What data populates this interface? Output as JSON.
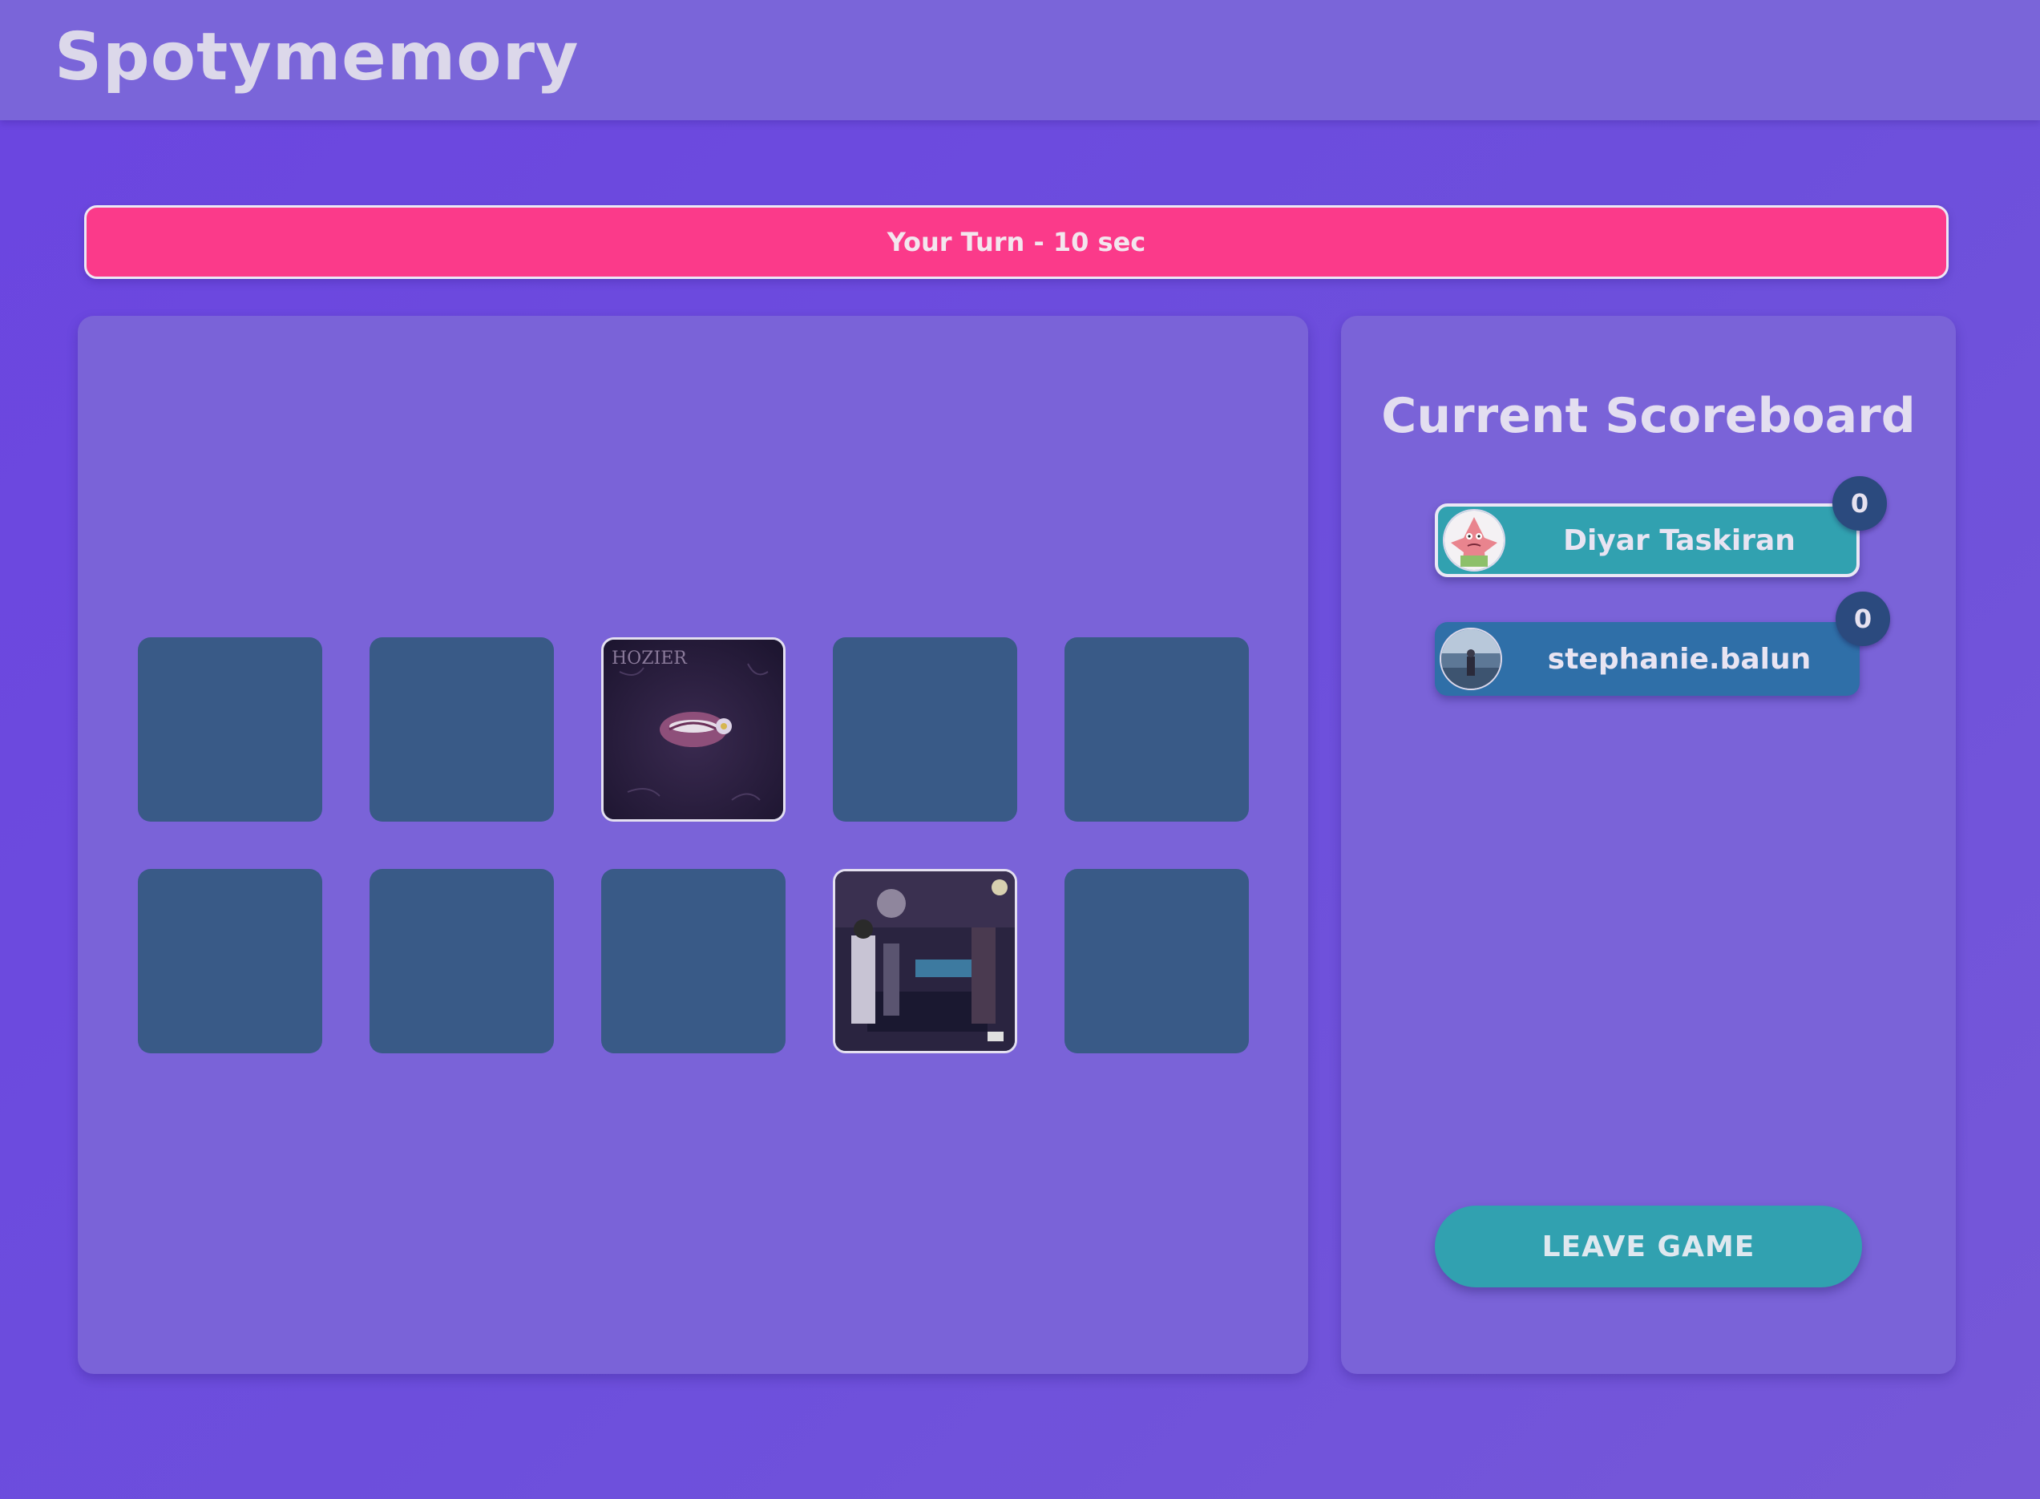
{
  "header": {
    "app_title": "Spotymemory"
  },
  "turn_banner": {
    "text": "Your Turn - 10 sec",
    "color": "#fb3a8a"
  },
  "board": {
    "rows": 2,
    "columns": 5,
    "cards": [
      {
        "state": "hidden"
      },
      {
        "state": "hidden"
      },
      {
        "state": "revealed",
        "image": "album-cover-dark-lips-flower"
      },
      {
        "state": "hidden"
      },
      {
        "state": "hidden"
      },
      {
        "state": "hidden"
      },
      {
        "state": "hidden"
      },
      {
        "state": "hidden"
      },
      {
        "state": "revealed",
        "image": "album-cover-bar-scene"
      },
      {
        "state": "hidden"
      }
    ]
  },
  "scoreboard": {
    "title": "Current Scoreboard",
    "players": [
      {
        "name": "Diyar Taskiran",
        "score": "0",
        "active": true,
        "avatar": "cartoon-starfish-avatar"
      },
      {
        "name": "stephanie.balun",
        "score": "0",
        "active": false,
        "avatar": "photo-avatar"
      }
    ],
    "leave_label": "LEAVE GAME"
  },
  "colors": {
    "background": "#6b45e0",
    "panel": "#7a63d8",
    "card_back": "#395a87",
    "active_player": "#31a1b0",
    "inactive_player": "#2f6fa8",
    "score_badge": "#2b4a7e"
  }
}
